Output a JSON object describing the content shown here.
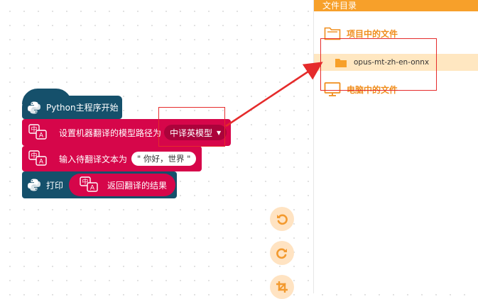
{
  "workspace": {
    "hat_block": {
      "label": "Python主程序开始"
    },
    "set_model_block": {
      "label": "设置机器翻译的模型路径为",
      "dropdown_value": "中译英模型"
    },
    "input_block": {
      "label": "输入待翻译文本为",
      "text_value": "\" 你好，世界 \""
    },
    "print_block": {
      "label": "打印",
      "reporter_label": "返回翻译的结果"
    }
  },
  "controls": [
    "undo-icon",
    "redo-icon",
    "crop-icon"
  ],
  "panel": {
    "title": "文件目录",
    "project_section": {
      "label": "项目中的文件",
      "icon": "folder-outline-icon"
    },
    "files": [
      {
        "name": "opus-mt-zh-en-onnx",
        "icon": "folder-icon"
      }
    ],
    "computer_section": {
      "label": "电脑中的文件",
      "icon": "monitor-icon"
    }
  },
  "colors": {
    "python_block": "#15506b",
    "translate_block": "#d6064a",
    "accent_orange": "#f7a02a",
    "highlight_red": "#e52b2b"
  }
}
